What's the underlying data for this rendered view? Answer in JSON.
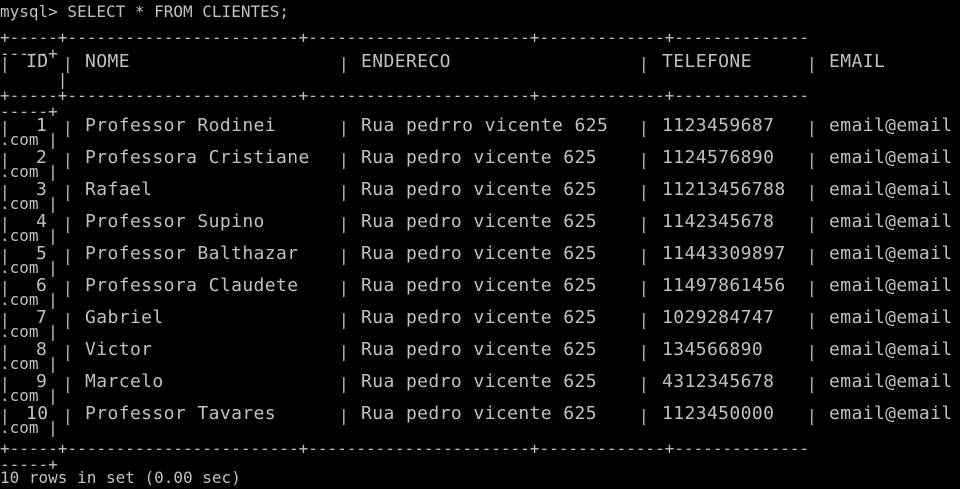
{
  "prompt_line": "mysql> SELECT * FROM CLIENTES;",
  "border_top": "+-----+------------------------+-----------------------+-------------+--------------",
  "border_top_tail": "-----+",
  "header": {
    "id": "ID",
    "nome": "NOME",
    "endereco": "ENDERECO",
    "telefone": "TELEFONE",
    "email": "EMAIL"
  },
  "border_mid": "+-----+------------------------+-----------------------+-------------+--------------",
  "border_mid_tail": "-----+",
  "rows": [
    {
      "id": "1",
      "nome": "Professor Rodinei",
      "endereco": "Rua pedrro vicente 625",
      "telefone": "1123459687",
      "email": "email@email",
      "tail": ".com |"
    },
    {
      "id": "2",
      "nome": "Professora Cristiane",
      "endereco": "Rua pedro vicente 625",
      "telefone": "1124576890",
      "email": "email@email",
      "tail": ".com |"
    },
    {
      "id": "3",
      "nome": "Rafael",
      "endereco": "Rua pedro vicente 625",
      "telefone": "11213456788",
      "email": "email@email",
      "tail": ".com |"
    },
    {
      "id": "4",
      "nome": "Professor Supino",
      "endereco": "Rua pedro vicente 625",
      "telefone": "1142345678",
      "email": "email@email",
      "tail": ".com |"
    },
    {
      "id": "5",
      "nome": "Professor Balthazar",
      "endereco": "Rua pedro vicente 625",
      "telefone": "11443309897",
      "email": "email@email",
      "tail": ".com |"
    },
    {
      "id": "6",
      "nome": "Professora Claudete",
      "endereco": "Rua pedro vicente 625",
      "telefone": "11497861456",
      "email": "email@email",
      "tail": ".com |"
    },
    {
      "id": "7",
      "nome": "Gabriel",
      "endereco": "Rua pedro vicente 625",
      "telefone": "1029284747",
      "email": "email@email",
      "tail": ".com |"
    },
    {
      "id": "8",
      "nome": "Victor",
      "endereco": "Rua pedro vicente 625",
      "telefone": "134566890",
      "email": "email@email",
      "tail": ".com |"
    },
    {
      "id": "9",
      "nome": "Marcelo",
      "endereco": "Rua pedro vicente 625",
      "telefone": "4312345678",
      "email": "email@email",
      "tail": ".com |"
    },
    {
      "id": "10",
      "nome": "Professor Tavares",
      "endereco": "Rua pedro vicente 625",
      "telefone": "1123450000",
      "email": "email@email",
      "tail": ".com |"
    }
  ],
  "border_bottom": "+-----+------------------------+-----------------------+-------------+--------------",
  "border_bottom_tail": "-----+",
  "footer": "10 rows in set (0.00 sec)",
  "colors": {
    "background": "#000000",
    "text": "#c0c0c0"
  }
}
